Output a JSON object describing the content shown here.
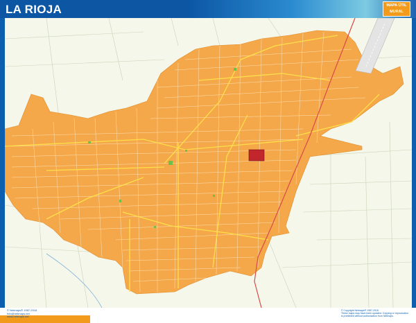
{
  "header": {
    "title": "LA RIOJA",
    "brand_line1": "MAPA ÚTIL",
    "brand_line2": "MURAL"
  },
  "footer": {
    "left_text": "© Netmaps® 1987-2018\nInfo@netmaps.net\nwww.netmaps.net",
    "right_text": "© Copyright Netmaps® 1987-2018\nThese maps may have been updated. Copying or reproduction is prohibited without authorization from Netmaps."
  },
  "colors": {
    "frame": "#0b5fae",
    "urban_area": "#f5a84a",
    "background": "#f4f7ea",
    "highlight_block": "#c0262c",
    "brand_badge": "#f29a1c",
    "rail_line": "#d84a4a",
    "main_road": "#ffe04a"
  },
  "map": {
    "features": [
      "urban-area",
      "street-grid",
      "main-roads",
      "railway",
      "airport-runway",
      "highlighted-block",
      "parks",
      "rural-roads"
    ]
  }
}
